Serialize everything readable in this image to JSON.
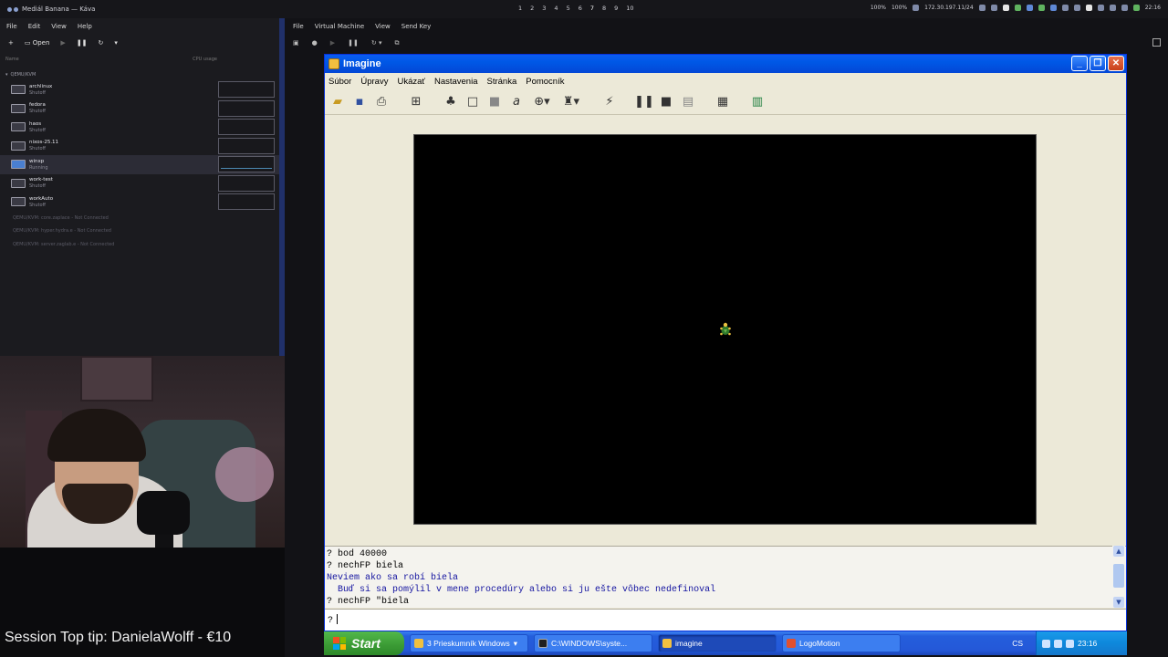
{
  "topbar": {
    "title": "Mediál Banana — Káva",
    "workspaces": [
      "1",
      "2",
      "3",
      "4",
      "5",
      "6",
      "7",
      "8",
      "9",
      "10"
    ],
    "active_workspace": "7",
    "stat1": "100%",
    "stat2": "100%",
    "ip": "172.30.197.11/24",
    "clock": "22:16"
  },
  "vm_manager": {
    "menu": [
      "File",
      "Edit",
      "View",
      "Help"
    ],
    "open_label": "Open",
    "col_name": "Name",
    "col_cpu": "CPU usage",
    "group": "QEMU/KVM",
    "vms": [
      {
        "name": "archlinux",
        "state": "Shutoff"
      },
      {
        "name": "fedora",
        "state": "Shutoff"
      },
      {
        "name": "haos",
        "state": "Shutoff"
      },
      {
        "name": "nixos-25.11",
        "state": "Shutoff"
      },
      {
        "name": "winxp",
        "state": "Running"
      },
      {
        "name": "work-test",
        "state": "Shutoff"
      },
      {
        "name": "workAuto",
        "state": "Shutoff"
      }
    ],
    "connections": [
      "QEMU/KVM: core.zaplace - Not Connected",
      "QEMU/KVM: hyper.hydra.e - Not Connected",
      "QEMU/KVM: server.zaglab.e - Not Connected"
    ]
  },
  "stream": {
    "tip_text": "Session Top tip: DanielaWolff - €10"
  },
  "viewer": {
    "menu": [
      "File",
      "Virtual Machine",
      "View",
      "Send Key"
    ]
  },
  "imagine": {
    "title": "Imagine",
    "menu": [
      "Súbor",
      "Úpravy",
      "Ukázať",
      "Nastavenia",
      "Stránka",
      "Pomocník"
    ],
    "output_lines": [
      {
        "text": "? bod 40000",
        "type": "cmd"
      },
      {
        "text": "? nechFP biela",
        "type": "cmd"
      },
      {
        "text": "Neviem ako sa robí biela",
        "type": "err"
      },
      {
        "text": "  Buď si sa pomýlil v mene procedúry alebo si ju ešte vôbec nedefinoval",
        "type": "err"
      },
      {
        "text": "? nechFP \"biela",
        "type": "cmd"
      }
    ],
    "input_prompt": "?"
  },
  "xp_taskbar": {
    "start": "Start",
    "tasks": [
      {
        "label": "3 Prieskumník Windows",
        "color": "#f0c040",
        "active": false
      },
      {
        "label": "C:\\WINDOWS\\syste...",
        "color": "#202020",
        "active": false
      },
      {
        "label": "imagine",
        "color": "#f3c040",
        "active": true
      },
      {
        "label": "LogoMotion",
        "color": "#e05030",
        "active": false
      }
    ],
    "lang": "CS",
    "clock": "23:16"
  },
  "colors": {
    "xp_blue": "#0058e6",
    "canvas": "#000000",
    "error_text": "#1414a0",
    "start_green": "#3a9a34"
  }
}
